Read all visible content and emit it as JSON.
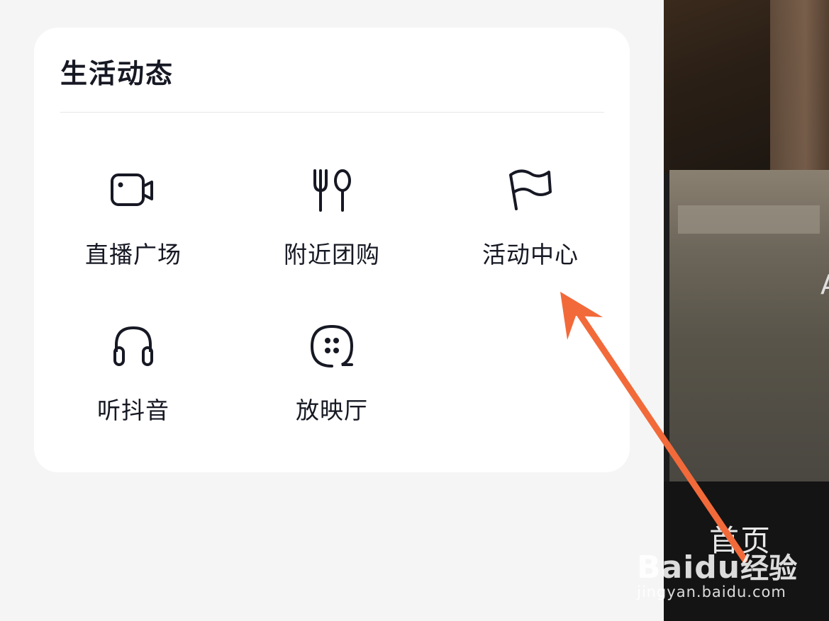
{
  "section": {
    "title": "生活动态"
  },
  "items": [
    {
      "label": "直播广场",
      "icon": "video-camera-icon"
    },
    {
      "label": "附近团购",
      "icon": "fork-spoon-icon"
    },
    {
      "label": "活动中心",
      "icon": "flag-icon"
    },
    {
      "label": "听抖音",
      "icon": "headphones-icon"
    },
    {
      "label": "放映厅",
      "icon": "film-reel-icon"
    }
  ],
  "background": {
    "home_tab": "首页",
    "side_text": "A"
  },
  "watermark": {
    "logo": "Baidu",
    "sub": "经验",
    "url": "jingyan.baidu.com"
  },
  "colors": {
    "text": "#161823",
    "card": "#ffffff",
    "page": "#f5f5f5",
    "annotation_arrow": "#f26a3a"
  }
}
